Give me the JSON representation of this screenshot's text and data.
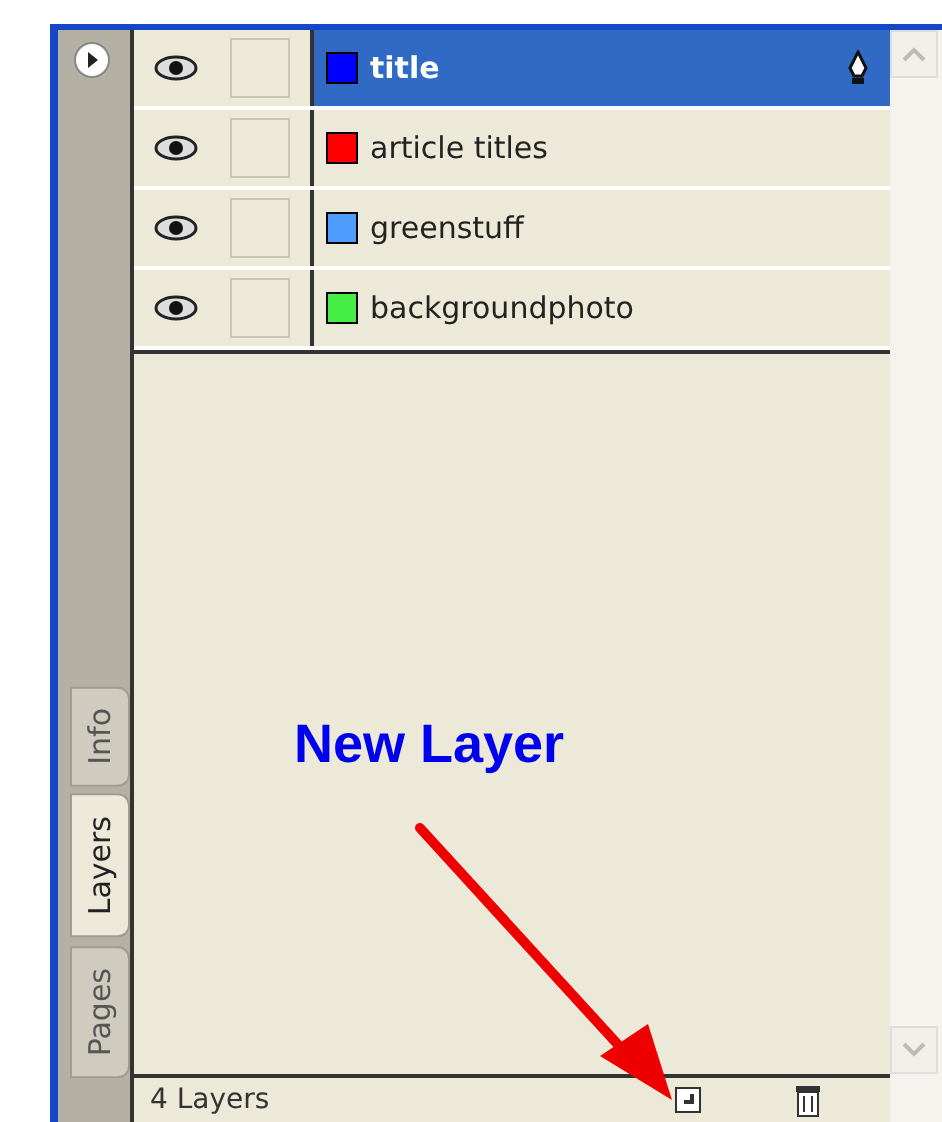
{
  "panel_tabs": [
    {
      "label": "Info",
      "selected": false
    },
    {
      "label": "Layers",
      "selected": true
    },
    {
      "label": "Pages",
      "selected": false
    }
  ],
  "layers": [
    {
      "name": "title",
      "color": "#0000ff",
      "selected": true,
      "visible": true
    },
    {
      "name": "article titles",
      "color": "#ff0000",
      "selected": false,
      "visible": true
    },
    {
      "name": "greenstuff",
      "color": "#4f9cff",
      "selected": false,
      "visible": true
    },
    {
      "name": "backgroundphoto",
      "color": "#44ee44",
      "selected": false,
      "visible": true
    }
  ],
  "footer": {
    "count": "4 Layers"
  },
  "annotation": {
    "label": "New Layer"
  }
}
